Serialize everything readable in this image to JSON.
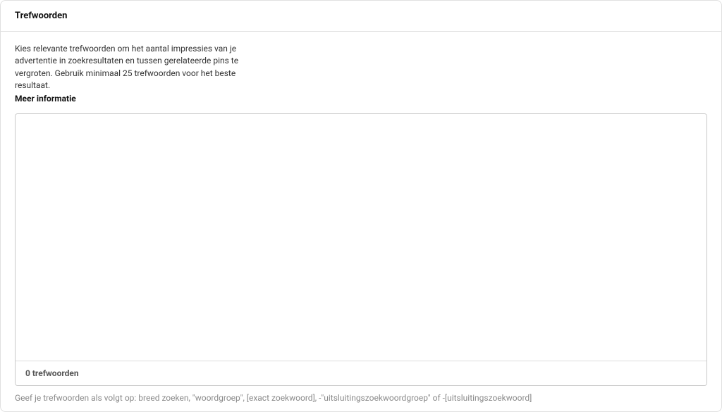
{
  "header": {
    "title": "Trefwoorden"
  },
  "body": {
    "description": "Kies relevante trefwoorden om het aantal impressies van je advertentie in zoekresultaten en tussen gerelateerde pins te vergroten. Gebruik minimaal 25 trefwoorden voor het beste resultaat.",
    "more_info_label": "Meer informatie"
  },
  "keywords": {
    "textarea_value": "",
    "count_label": "0 trefwoorden"
  },
  "helper": {
    "text": "Geef je trefwoorden als volgt op: breed zoeken, \"woordgroep\", [exact zoekwoord], -\"uitsluitingszoekwoordgroep\" of -[uitsluitingszoekwoord]"
  }
}
